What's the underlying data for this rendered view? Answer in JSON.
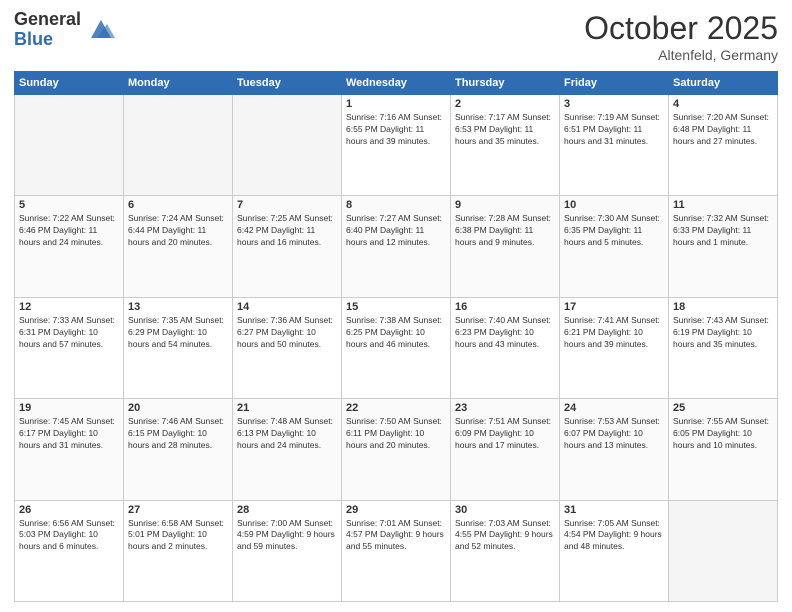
{
  "header": {
    "logo_general": "General",
    "logo_blue": "Blue",
    "month_title": "October 2025",
    "subtitle": "Altenfeld, Germany"
  },
  "days_of_week": [
    "Sunday",
    "Monday",
    "Tuesday",
    "Wednesday",
    "Thursday",
    "Friday",
    "Saturday"
  ],
  "weeks": [
    [
      {
        "day": "",
        "content": ""
      },
      {
        "day": "",
        "content": ""
      },
      {
        "day": "",
        "content": ""
      },
      {
        "day": "1",
        "content": "Sunrise: 7:16 AM\nSunset: 6:55 PM\nDaylight: 11 hours\nand 39 minutes."
      },
      {
        "day": "2",
        "content": "Sunrise: 7:17 AM\nSunset: 6:53 PM\nDaylight: 11 hours\nand 35 minutes."
      },
      {
        "day": "3",
        "content": "Sunrise: 7:19 AM\nSunset: 6:51 PM\nDaylight: 11 hours\nand 31 minutes."
      },
      {
        "day": "4",
        "content": "Sunrise: 7:20 AM\nSunset: 6:48 PM\nDaylight: 11 hours\nand 27 minutes."
      }
    ],
    [
      {
        "day": "5",
        "content": "Sunrise: 7:22 AM\nSunset: 6:46 PM\nDaylight: 11 hours\nand 24 minutes."
      },
      {
        "day": "6",
        "content": "Sunrise: 7:24 AM\nSunset: 6:44 PM\nDaylight: 11 hours\nand 20 minutes."
      },
      {
        "day": "7",
        "content": "Sunrise: 7:25 AM\nSunset: 6:42 PM\nDaylight: 11 hours\nand 16 minutes."
      },
      {
        "day": "8",
        "content": "Sunrise: 7:27 AM\nSunset: 6:40 PM\nDaylight: 11 hours\nand 12 minutes."
      },
      {
        "day": "9",
        "content": "Sunrise: 7:28 AM\nSunset: 6:38 PM\nDaylight: 11 hours\nand 9 minutes."
      },
      {
        "day": "10",
        "content": "Sunrise: 7:30 AM\nSunset: 6:35 PM\nDaylight: 11 hours\nand 5 minutes."
      },
      {
        "day": "11",
        "content": "Sunrise: 7:32 AM\nSunset: 6:33 PM\nDaylight: 11 hours\nand 1 minute."
      }
    ],
    [
      {
        "day": "12",
        "content": "Sunrise: 7:33 AM\nSunset: 6:31 PM\nDaylight: 10 hours\nand 57 minutes."
      },
      {
        "day": "13",
        "content": "Sunrise: 7:35 AM\nSunset: 6:29 PM\nDaylight: 10 hours\nand 54 minutes."
      },
      {
        "day": "14",
        "content": "Sunrise: 7:36 AM\nSunset: 6:27 PM\nDaylight: 10 hours\nand 50 minutes."
      },
      {
        "day": "15",
        "content": "Sunrise: 7:38 AM\nSunset: 6:25 PM\nDaylight: 10 hours\nand 46 minutes."
      },
      {
        "day": "16",
        "content": "Sunrise: 7:40 AM\nSunset: 6:23 PM\nDaylight: 10 hours\nand 43 minutes."
      },
      {
        "day": "17",
        "content": "Sunrise: 7:41 AM\nSunset: 6:21 PM\nDaylight: 10 hours\nand 39 minutes."
      },
      {
        "day": "18",
        "content": "Sunrise: 7:43 AM\nSunset: 6:19 PM\nDaylight: 10 hours\nand 35 minutes."
      }
    ],
    [
      {
        "day": "19",
        "content": "Sunrise: 7:45 AM\nSunset: 6:17 PM\nDaylight: 10 hours\nand 31 minutes."
      },
      {
        "day": "20",
        "content": "Sunrise: 7:46 AM\nSunset: 6:15 PM\nDaylight: 10 hours\nand 28 minutes."
      },
      {
        "day": "21",
        "content": "Sunrise: 7:48 AM\nSunset: 6:13 PM\nDaylight: 10 hours\nand 24 minutes."
      },
      {
        "day": "22",
        "content": "Sunrise: 7:50 AM\nSunset: 6:11 PM\nDaylight: 10 hours\nand 20 minutes."
      },
      {
        "day": "23",
        "content": "Sunrise: 7:51 AM\nSunset: 6:09 PM\nDaylight: 10 hours\nand 17 minutes."
      },
      {
        "day": "24",
        "content": "Sunrise: 7:53 AM\nSunset: 6:07 PM\nDaylight: 10 hours\nand 13 minutes."
      },
      {
        "day": "25",
        "content": "Sunrise: 7:55 AM\nSunset: 6:05 PM\nDaylight: 10 hours\nand 10 minutes."
      }
    ],
    [
      {
        "day": "26",
        "content": "Sunrise: 6:56 AM\nSunset: 5:03 PM\nDaylight: 10 hours\nand 6 minutes."
      },
      {
        "day": "27",
        "content": "Sunrise: 6:58 AM\nSunset: 5:01 PM\nDaylight: 10 hours\nand 2 minutes."
      },
      {
        "day": "28",
        "content": "Sunrise: 7:00 AM\nSunset: 4:59 PM\nDaylight: 9 hours\nand 59 minutes."
      },
      {
        "day": "29",
        "content": "Sunrise: 7:01 AM\nSunset: 4:57 PM\nDaylight: 9 hours\nand 55 minutes."
      },
      {
        "day": "30",
        "content": "Sunrise: 7:03 AM\nSunset: 4:55 PM\nDaylight: 9 hours\nand 52 minutes."
      },
      {
        "day": "31",
        "content": "Sunrise: 7:05 AM\nSunset: 4:54 PM\nDaylight: 9 hours\nand 48 minutes."
      },
      {
        "day": "",
        "content": ""
      }
    ]
  ]
}
